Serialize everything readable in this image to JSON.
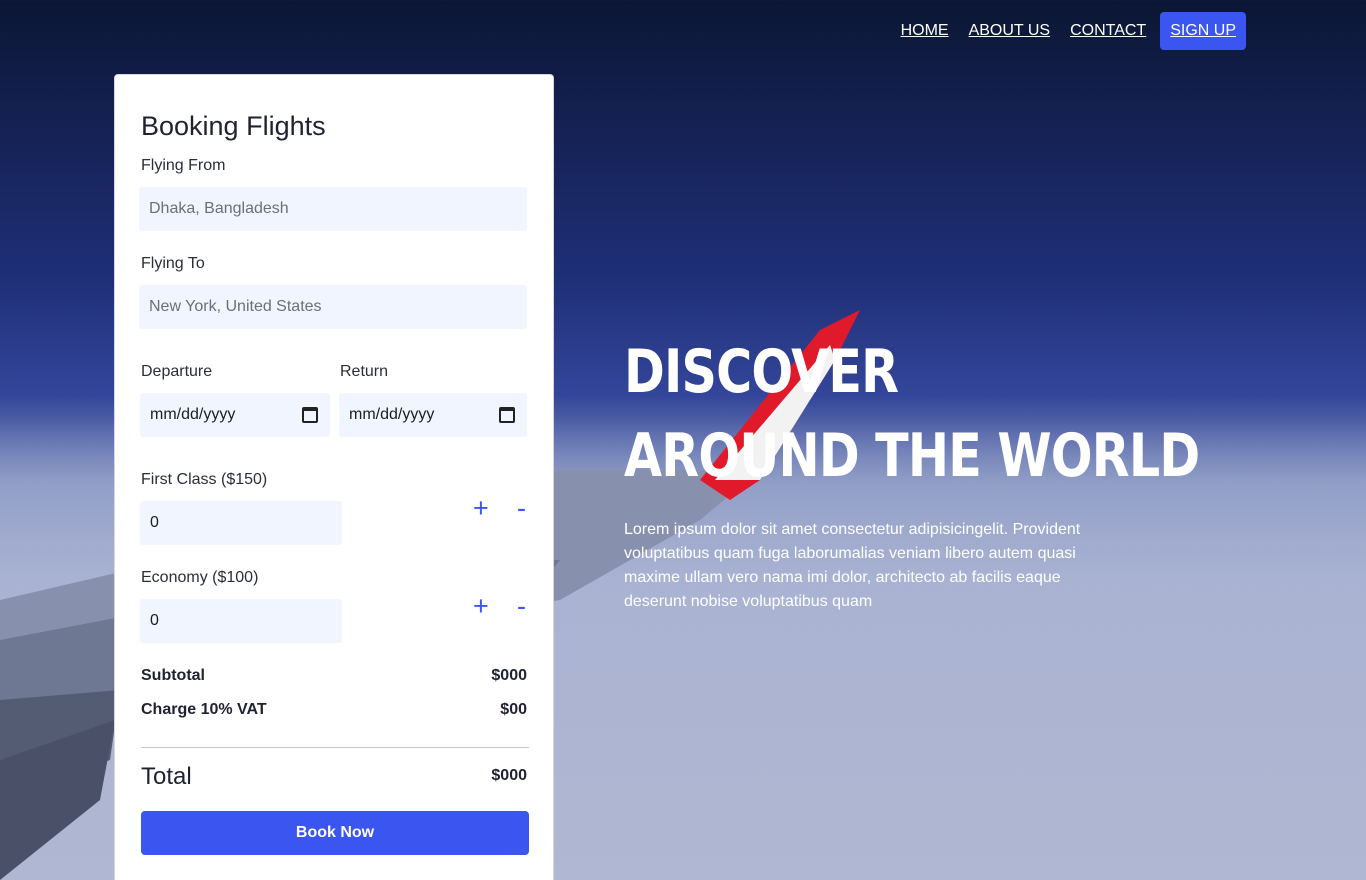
{
  "nav": {
    "items": [
      "HOME",
      "ABOUT US",
      "CONTACT"
    ],
    "signup_label": "SIGN UP"
  },
  "booking": {
    "title": "Booking Flights",
    "from_label": "Flying From",
    "from_placeholder": "Dhaka, Bangladesh",
    "to_label": "Flying To",
    "to_placeholder": "New York, United States",
    "departure_label": "Departure",
    "departure_value": "mm/dd/yyyy",
    "return_label": "Return",
    "return_value": "mm/dd/yyyy",
    "first_class_label": "First Class ($150)",
    "first_class_value": "0",
    "economy_label": "Economy ($100)",
    "economy_value": "0",
    "plus": "+",
    "minus": "-",
    "subtotal_label": "Subtotal",
    "subtotal_value": "$000",
    "vat_label": "Charge 10% VAT",
    "vat_value": "$00",
    "total_label": "Total",
    "total_value": "$000",
    "book_button": "Book Now"
  },
  "hero": {
    "line1": "DISCOVER",
    "line2": "AROUND THE WORLD",
    "text": "Lorem ipsum dolor sit amet consectetur adipisicingelit. Provident voluptatibus quam fuga laborumalias veniam libero autem quasi maxime ullam vero nama imi dolor, architecto ab facilis eaque deserunt nobise voluptatibus quam"
  },
  "colors": {
    "accent": "#3a55f0",
    "input_bg": "#f1f5ff"
  }
}
